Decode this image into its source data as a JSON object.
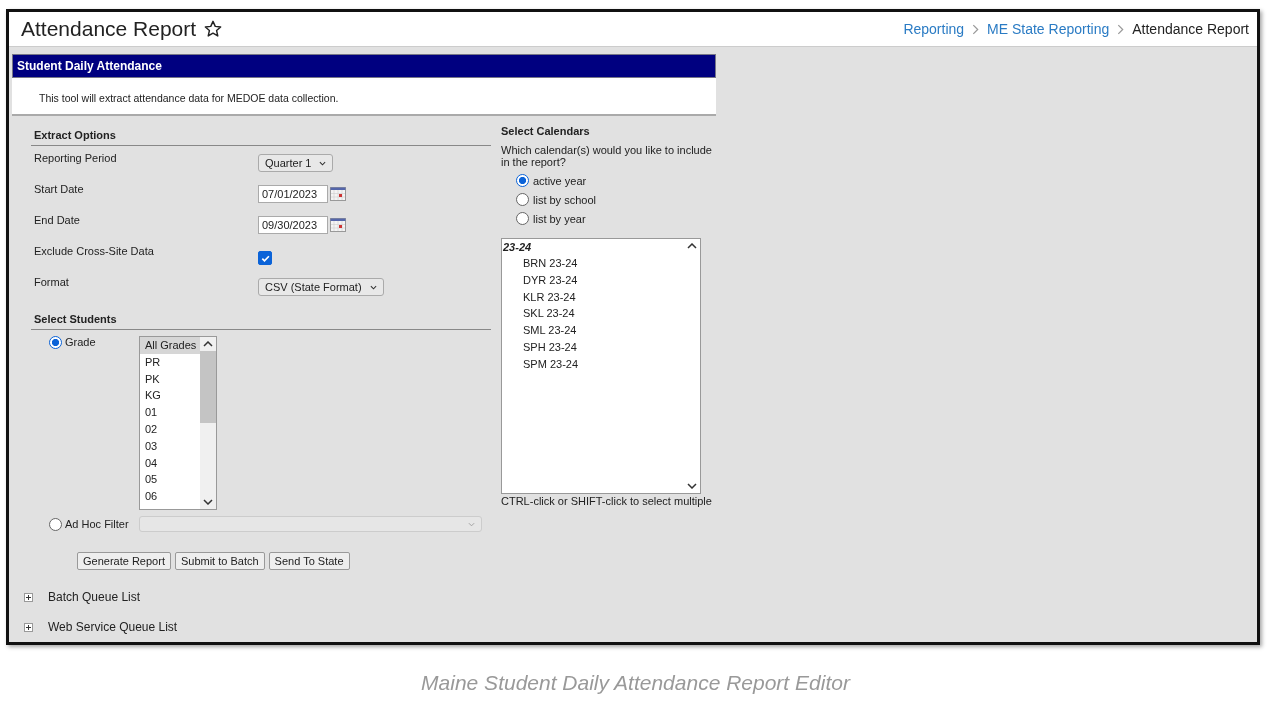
{
  "header": {
    "title": "Attendance Report",
    "favorite": false,
    "breadcrumb": [
      {
        "label": "Reporting",
        "link": true
      },
      {
        "label": "ME State Reporting",
        "link": true
      },
      {
        "label": "Attendance Report",
        "link": false
      }
    ]
  },
  "panel": {
    "title": "Student Daily Attendance",
    "description": "This tool will extract attendance data for MEDOE data collection."
  },
  "extract_options": {
    "heading": "Extract Options",
    "fields": [
      {
        "kind": "select",
        "label": "Reporting Period",
        "value": "Quarter 1"
      },
      {
        "kind": "date",
        "label": "Start Date",
        "value": "07/01/2023"
      },
      {
        "kind": "date",
        "label": "End Date",
        "value": "09/30/2023"
      },
      {
        "kind": "checkbox",
        "label": "Exclude Cross-Site Data",
        "checked": true
      },
      {
        "kind": "select",
        "label": "Format",
        "value": "CSV (State Format)"
      }
    ]
  },
  "select_students": {
    "heading": "Select Students",
    "options": [
      {
        "label": "Grade",
        "selected": true,
        "kind": "list",
        "items": [
          {
            "label": "All Grades",
            "selected": true
          },
          {
            "label": "PR",
            "selected": false
          },
          {
            "label": "PK",
            "selected": false
          },
          {
            "label": "KG",
            "selected": false
          },
          {
            "label": "01",
            "selected": false
          },
          {
            "label": "02",
            "selected": false
          },
          {
            "label": "03",
            "selected": false
          },
          {
            "label": "04",
            "selected": false
          },
          {
            "label": "05",
            "selected": false
          },
          {
            "label": "06",
            "selected": false
          }
        ]
      },
      {
        "label": "Ad Hoc Filter",
        "selected": false,
        "kind": "dropdown",
        "disabled": true
      }
    ]
  },
  "buttons": [
    "Generate Report",
    "Submit to Batch",
    "Send To State"
  ],
  "queues": [
    {
      "label": "Batch Queue List",
      "expanded": false
    },
    {
      "label": "Web Service Queue List",
      "expanded": false
    }
  ],
  "calendars": {
    "heading": "Select Calendars",
    "question": "Which calendar(s) would you like to include in the report?",
    "options": [
      {
        "label": "active year",
        "selected": true
      },
      {
        "label": "list by school",
        "selected": false
      },
      {
        "label": "list by year",
        "selected": false
      }
    ],
    "groups": [
      {
        "label": "23-24",
        "children": [
          {
            "label": "BRN 23-24",
            "selected": false
          },
          {
            "label": "DYR 23-24",
            "selected": false
          },
          {
            "label": "KLR 23-24",
            "selected": false
          },
          {
            "label": "SKL 23-24",
            "selected": false
          },
          {
            "label": "SML 23-24",
            "selected": false
          },
          {
            "label": "SPH 23-24",
            "selected": false
          },
          {
            "label": "SPM 23-24",
            "selected": false
          }
        ]
      }
    ],
    "hint": "CTRL-click or SHIFT-click to select multiple"
  },
  "caption": "Maine Student Daily Attendance Report Editor"
}
